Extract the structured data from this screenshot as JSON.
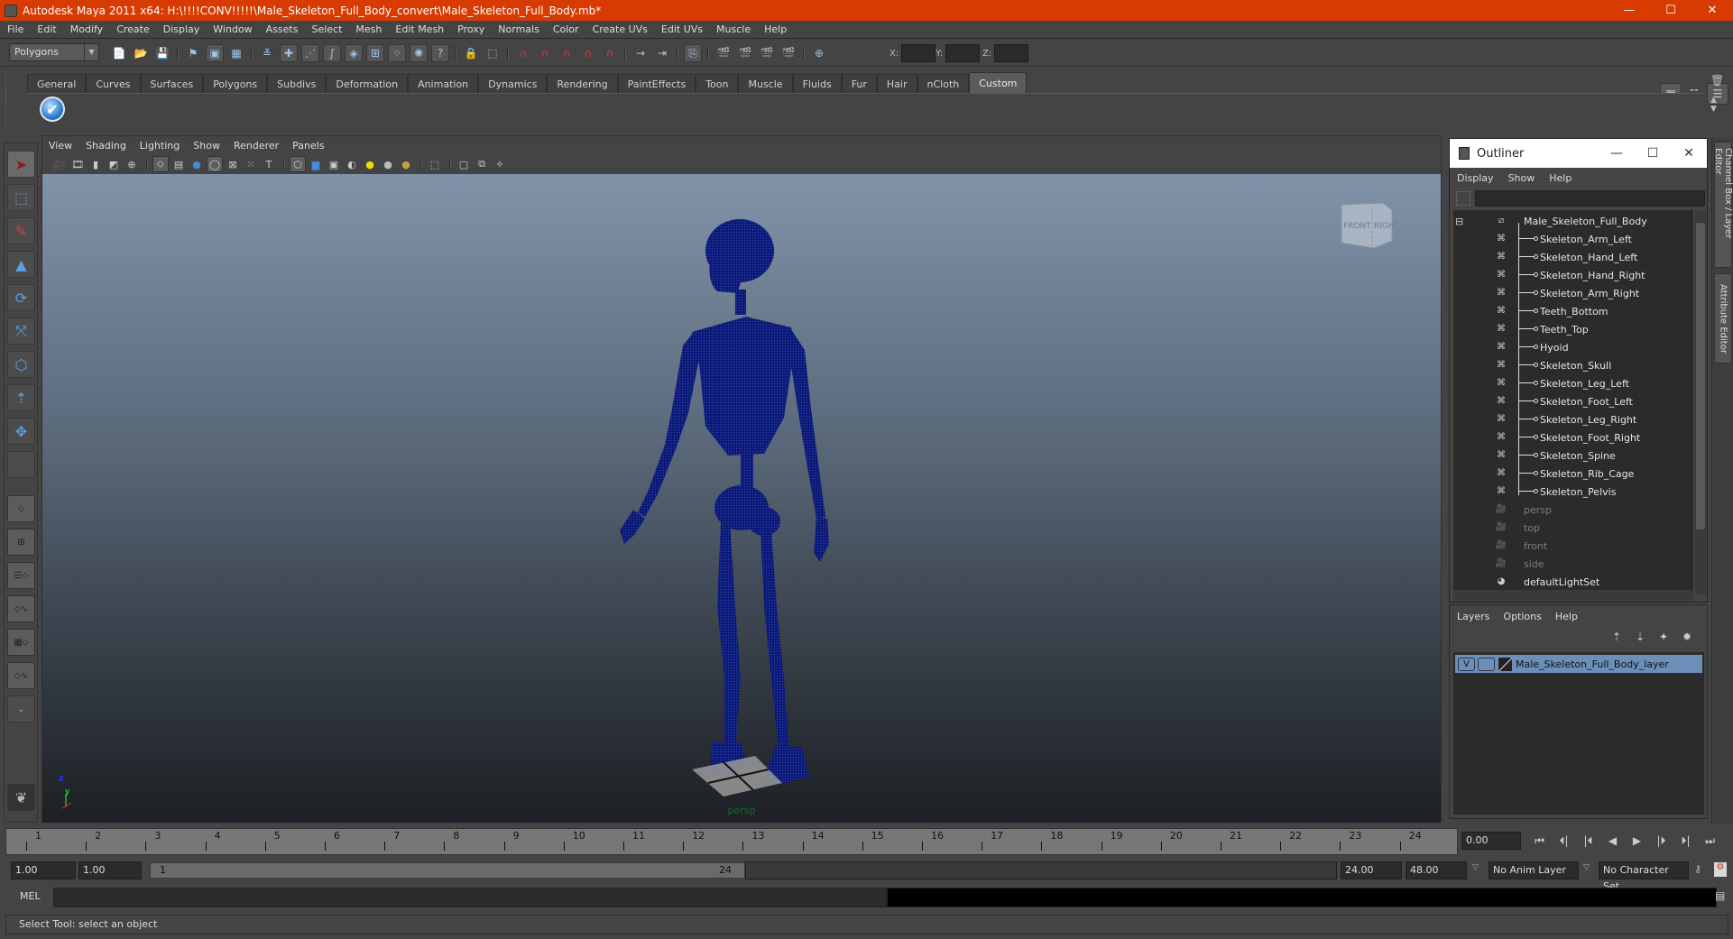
{
  "window": {
    "title": "Autodesk Maya 2011 x64: H:\\!!!!CONV!!!!!\\Male_Skeleton_Full_Body_convert\\Male_Skeleton_Full_Body.mb*",
    "controls": {
      "minimize": "—",
      "maximize": "☐",
      "close": "✕"
    },
    "accent_color": "#d83b01"
  },
  "menubar": [
    "File",
    "Edit",
    "Modify",
    "Create",
    "Display",
    "Window",
    "Assets",
    "Select",
    "Mesh",
    "Edit Mesh",
    "Proxy",
    "Normals",
    "Color",
    "Create UVs",
    "Edit UVs",
    "Muscle",
    "Help"
  ],
  "toolbar": {
    "menu_set": "Polygons",
    "coord_labels": {
      "x": "X:",
      "y": "Y:",
      "z": "Z:"
    },
    "coord_values": {
      "x": "",
      "y": "",
      "z": ""
    },
    "icons": [
      "new-scene-icon",
      "open-scene-icon",
      "save-scene-icon",
      "select-hierarchy-icon",
      "select-object-icon",
      "select-component-icon",
      "mask-icon",
      "vertex-icon",
      "edge-icon",
      "curve-icon",
      "face-icon",
      "uv-icon",
      "particle-icon",
      "misc-icon",
      "help-icon",
      "lock-icon",
      "highlight-selection-icon",
      "snap-grid-icon",
      "snap-curve-icon",
      "snap-point-icon",
      "snap-surface-icon",
      "snap-live-icon",
      "input-ops-icon",
      "output-ops-icon",
      "construction-history-icon",
      "render-view-icon",
      "render-icon",
      "ipr-render-icon",
      "render-settings-icon",
      "transform-icon"
    ],
    "right_icons": [
      "channel-box-icon",
      "attribute-editor-icon",
      "tool-settings-icon"
    ]
  },
  "shelf": {
    "tabs": [
      "General",
      "Curves",
      "Surfaces",
      "Polygons",
      "Subdivs",
      "Deformation",
      "Animation",
      "Dynamics",
      "Rendering",
      "PaintEffects",
      "Toon",
      "Muscle",
      "Fluids",
      "Fur",
      "Hair",
      "nCloth",
      "Custom"
    ],
    "active_tab": "Custom",
    "items": [
      {
        "icon": "checkmark-icon",
        "glyph": "✔"
      }
    ]
  },
  "toolbox": {
    "tools": [
      {
        "name": "select-tool",
        "glyph": "➤",
        "selected": true
      },
      {
        "name": "lasso-tool",
        "glyph": "⬚"
      },
      {
        "name": "paint-select-tool",
        "glyph": "✎"
      },
      {
        "name": "move-tool",
        "glyph": "▲"
      },
      {
        "name": "rotate-tool",
        "glyph": "⟳"
      },
      {
        "name": "scale-tool",
        "glyph": "⤧"
      },
      {
        "name": "universal-manipulator",
        "glyph": "⬡"
      },
      {
        "name": "soft-mod-tool",
        "glyph": "⇡"
      },
      {
        "name": "show-manipulator",
        "glyph": "✥"
      },
      {
        "name": "last-tool",
        "glyph": ""
      }
    ],
    "layouts": [
      "single-perspective-layout",
      "four-view-layout",
      "outliner-persp-layout",
      "persp-graph-layout",
      "hypershade-persp-layout",
      "persp-graph-hypergraph-layout"
    ],
    "expand_glyph": "⌄"
  },
  "viewport": {
    "menu": [
      "View",
      "Shading",
      "Lighting",
      "Show",
      "Renderer",
      "Panels"
    ],
    "camera": "persp",
    "viewcube": {
      "front": "FRONT",
      "right": "RIGHT"
    },
    "axis": {
      "y": "y",
      "z": "z"
    },
    "model_color": "#0b1a7a"
  },
  "outliner": {
    "title": "Outliner",
    "menu": [
      "Display",
      "Show",
      "Help"
    ],
    "filter_value": "",
    "root": "Male_Skeleton_Full_Body",
    "children": [
      "Skeleton_Arm_Left",
      "Skeleton_Hand_Left",
      "Skeleton_Hand_Right",
      "Skeleton_Arm_Right",
      "Teeth_Bottom",
      "Teeth_Top",
      "Hyoid",
      "Skeleton_Skull",
      "Skeleton_Leg_Left",
      "Skeleton_Foot_Left",
      "Skeleton_Leg_Right",
      "Skeleton_Foot_Right",
      "Skeleton_Spine",
      "Skeleton_Rib_Cage",
      "Skeleton_Pelvis"
    ],
    "cameras": [
      "persp",
      "top",
      "front",
      "side"
    ],
    "sets": [
      "defaultLightSet"
    ]
  },
  "layers": {
    "menu": [
      "Layers",
      "Options",
      "Help"
    ],
    "rows": [
      {
        "visible": "V",
        "playback": "",
        "name": "Male_Skeleton_Full_Body_layer"
      }
    ],
    "selected_color": "#6b8fb8"
  },
  "right_tabs": [
    "Channel Box / Layer Editor",
    "Attribute Editor"
  ],
  "timeline": {
    "ticks": [
      "1",
      "2",
      "3",
      "4",
      "5",
      "6",
      "7",
      "8",
      "9",
      "10",
      "11",
      "12",
      "13",
      "14",
      "15",
      "16",
      "17",
      "18",
      "19",
      "20",
      "21",
      "22",
      "23",
      "24"
    ],
    "current_frame": "0.00",
    "play_controls": [
      "⏮",
      "⏴|",
      "|⏴",
      "◀",
      "▶",
      "|⏵",
      "⏵|",
      "⏭"
    ]
  },
  "range": {
    "start": "1.00",
    "playback_start": "1.00",
    "slider_start": "1",
    "slider_end": "24",
    "playback_end": "24.00",
    "end": "48.00",
    "anim_layer": "No Anim Layer",
    "character_set": "No Character Set"
  },
  "command_line": {
    "label": "MEL",
    "value": "",
    "output": ""
  },
  "help_line": "Select Tool: select an object"
}
